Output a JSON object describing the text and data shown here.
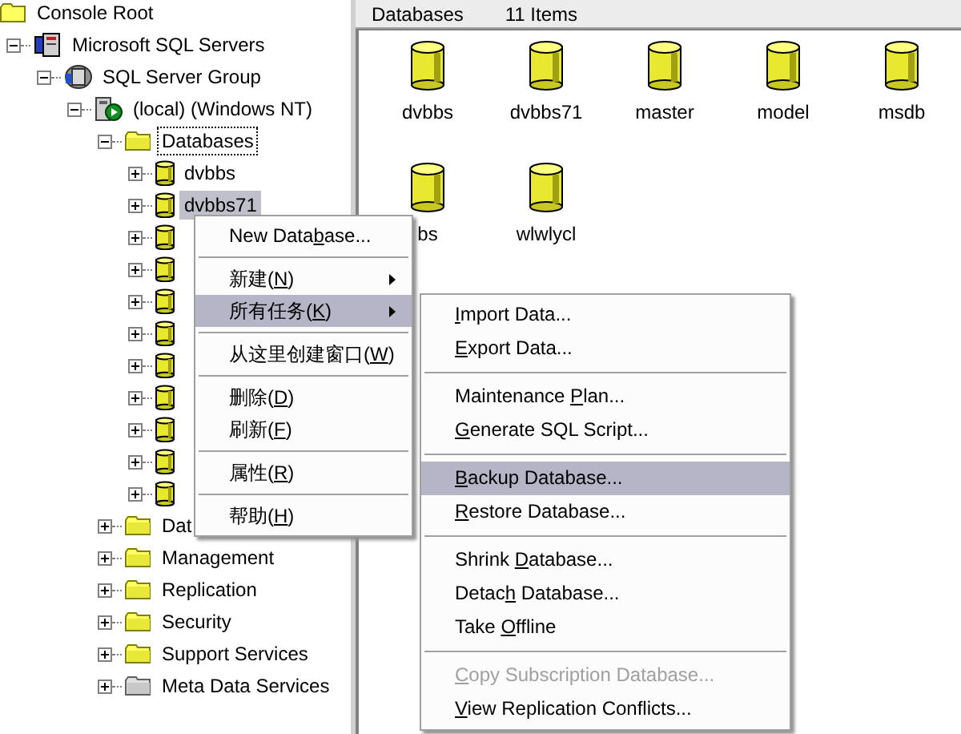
{
  "tree": [
    {
      "kind": "root",
      "label": "Console Root",
      "selected": false,
      "focused": false,
      "children": [
        {
          "kind": "servers",
          "label": "Microsoft SQL Servers",
          "expanded": true,
          "selected": false,
          "focused": false,
          "children": [
            {
              "kind": "group",
              "label": "SQL Server Group",
              "expanded": true,
              "selected": false,
              "focused": false,
              "children": [
                {
                  "kind": "server",
                  "label": "(local) (Windows NT)",
                  "expanded": true,
                  "selected": false,
                  "focused": false,
                  "children": [
                    {
                      "kind": "folder",
                      "label": "Databases",
                      "expanded": true,
                      "selected": false,
                      "focused": true,
                      "children": [
                        {
                          "kind": "database",
                          "label": "dvbbs",
                          "expanded": false,
                          "selected": false,
                          "focused": false
                        },
                        {
                          "kind": "database",
                          "label": "dvbbs71",
                          "expanded": false,
                          "selected": true,
                          "focused": false
                        },
                        {
                          "kind": "database",
                          "expanded": false
                        },
                        {
                          "kind": "database",
                          "expanded": false
                        },
                        {
                          "kind": "database",
                          "expanded": false
                        },
                        {
                          "kind": "database",
                          "expanded": false
                        },
                        {
                          "kind": "database",
                          "expanded": false
                        },
                        {
                          "kind": "database",
                          "expanded": false
                        },
                        {
                          "kind": "database",
                          "expanded": false
                        },
                        {
                          "kind": "database",
                          "expanded": false
                        },
                        {
                          "kind": "database",
                          "expanded": false
                        }
                      ]
                    },
                    {
                      "kind": "folder",
                      "label": "Dat",
                      "expanded": false,
                      "selected": false,
                      "focused": false
                    },
                    {
                      "kind": "folder",
                      "label": "Management",
                      "expanded": false,
                      "selected": false,
                      "focused": false
                    },
                    {
                      "kind": "folder",
                      "label": "Replication",
                      "expanded": false,
                      "selected": false,
                      "focused": false
                    },
                    {
                      "kind": "folder",
                      "label": "Security",
                      "expanded": false,
                      "selected": false,
                      "focused": false
                    },
                    {
                      "kind": "folder",
                      "label": "Support Services",
                      "expanded": false,
                      "selected": false,
                      "focused": false
                    },
                    {
                      "kind": "meta",
                      "label": "Meta Data Services",
                      "expanded": false,
                      "selected": false,
                      "focused": false
                    }
                  ]
                }
              ]
            }
          ]
        }
      ]
    }
  ],
  "list_pane": {
    "title": "Databases",
    "count": "11 Items",
    "items": [
      {
        "label": "dvbbs"
      },
      {
        "label": "dvbbs71"
      },
      {
        "label": "master"
      },
      {
        "label": "model"
      },
      {
        "label": "msdb"
      },
      {
        "label": "bs"
      },
      {
        "label": "wlwlycl"
      }
    ]
  },
  "context_menu": {
    "items": [
      {
        "kind": "item",
        "pre": "New Data",
        "key": "b",
        "post": "ase...",
        "submenu": false,
        "selected": false,
        "disabled": false
      },
      {
        "kind": "separator"
      },
      {
        "kind": "item",
        "pre": "新建(",
        "key": "N",
        "post": ")",
        "submenu": true,
        "selected": false,
        "disabled": false
      },
      {
        "kind": "item",
        "pre": "所有任务(",
        "key": "K",
        "post": ")",
        "submenu": true,
        "selected": true,
        "disabled": false
      },
      {
        "kind": "separator"
      },
      {
        "kind": "item",
        "pre": "从这里创建窗口(",
        "key": "W",
        "post": ")",
        "submenu": false,
        "selected": false,
        "disabled": false
      },
      {
        "kind": "separator"
      },
      {
        "kind": "item",
        "pre": "删除(",
        "key": "D",
        "post": ")",
        "submenu": false,
        "selected": false,
        "disabled": false
      },
      {
        "kind": "item",
        "pre": "刷新(",
        "key": "F",
        "post": ")",
        "submenu": false,
        "selected": false,
        "disabled": false
      },
      {
        "kind": "separator"
      },
      {
        "kind": "item",
        "pre": "属性(",
        "key": "R",
        "post": ")",
        "submenu": false,
        "selected": false,
        "disabled": false
      },
      {
        "kind": "separator"
      },
      {
        "kind": "item",
        "pre": "帮助(",
        "key": "H",
        "post": ")",
        "submenu": false,
        "selected": false,
        "disabled": false
      }
    ]
  },
  "submenu": {
    "items": [
      {
        "kind": "item",
        "key": "I",
        "post": "mport Data...",
        "submenu": false,
        "selected": false,
        "disabled": false
      },
      {
        "kind": "item",
        "key": "E",
        "post": "xport Data...",
        "submenu": false,
        "selected": false,
        "disabled": false
      },
      {
        "kind": "separator"
      },
      {
        "kind": "item",
        "pre": "Maintenance ",
        "key": "P",
        "post": "lan...",
        "submenu": false,
        "selected": false,
        "disabled": false
      },
      {
        "kind": "item",
        "key": "G",
        "post": "enerate SQL Script...",
        "submenu": false,
        "selected": false,
        "disabled": false
      },
      {
        "kind": "separator"
      },
      {
        "kind": "item",
        "key": "B",
        "post": "ackup Database...",
        "submenu": false,
        "selected": true,
        "disabled": false
      },
      {
        "kind": "item",
        "key": "R",
        "post": "estore Database...",
        "submenu": false,
        "selected": false,
        "disabled": false
      },
      {
        "kind": "separator"
      },
      {
        "kind": "item",
        "pre": "Shrink ",
        "key": "D",
        "post": "atabase...",
        "submenu": false,
        "selected": false,
        "disabled": false
      },
      {
        "kind": "item",
        "pre": "Detac",
        "key": "h",
        "post": " Database...",
        "submenu": false,
        "selected": false,
        "disabled": false
      },
      {
        "kind": "item",
        "pre": "Take ",
        "key": "O",
        "post": "ffline",
        "submenu": false,
        "selected": false,
        "disabled": false
      },
      {
        "kind": "separator"
      },
      {
        "kind": "item",
        "key": "C",
        "post": "opy Subscription Database...",
        "submenu": false,
        "selected": false,
        "disabled": true
      },
      {
        "kind": "item",
        "key": "V",
        "post": "iew Replication Conflicts...",
        "submenu": false,
        "selected": false,
        "disabled": false
      }
    ]
  }
}
